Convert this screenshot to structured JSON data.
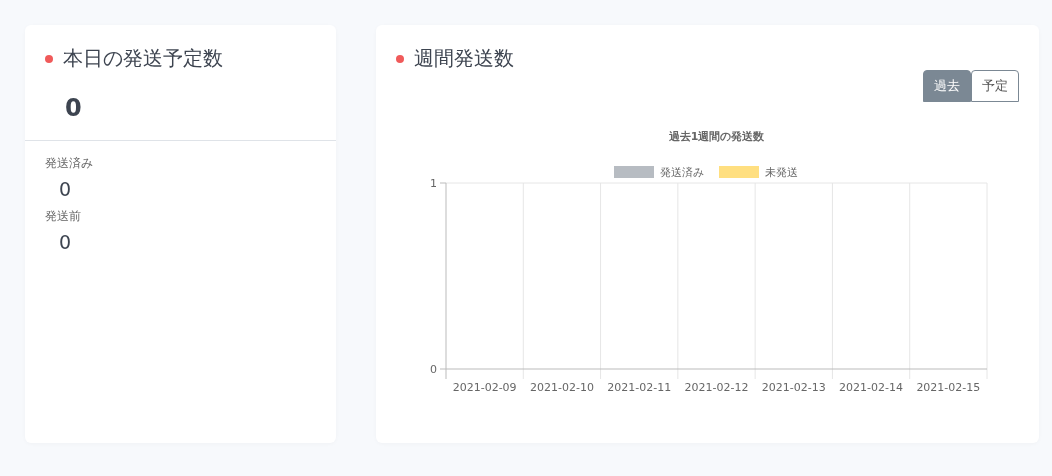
{
  "today_card": {
    "title": "本日の発送予定数",
    "total": "0",
    "stats": [
      {
        "label": "発送済み",
        "value": "0"
      },
      {
        "label": "発送前",
        "value": "0"
      }
    ]
  },
  "weekly_card": {
    "title": "週間発送数",
    "tabs": [
      {
        "label": "過去",
        "selected": true
      },
      {
        "label": "予定",
        "selected": false
      }
    ],
    "chart_data": {
      "type": "bar",
      "title": "過去1週間の発送数",
      "categories": [
        "2021-02-09",
        "2021-02-10",
        "2021-02-11",
        "2021-02-12",
        "2021-02-13",
        "2021-02-14",
        "2021-02-15"
      ],
      "ylim": [
        0,
        1
      ],
      "yticks": [
        0,
        1
      ],
      "series": [
        {
          "name": "発送済み",
          "color": "#b7bcc2",
          "values": [
            0,
            0,
            0,
            0,
            0,
            0,
            0
          ]
        },
        {
          "name": "未発送",
          "color": "#ffdf80",
          "values": [
            0,
            0,
            0,
            0,
            0,
            0,
            0
          ]
        }
      ]
    }
  }
}
